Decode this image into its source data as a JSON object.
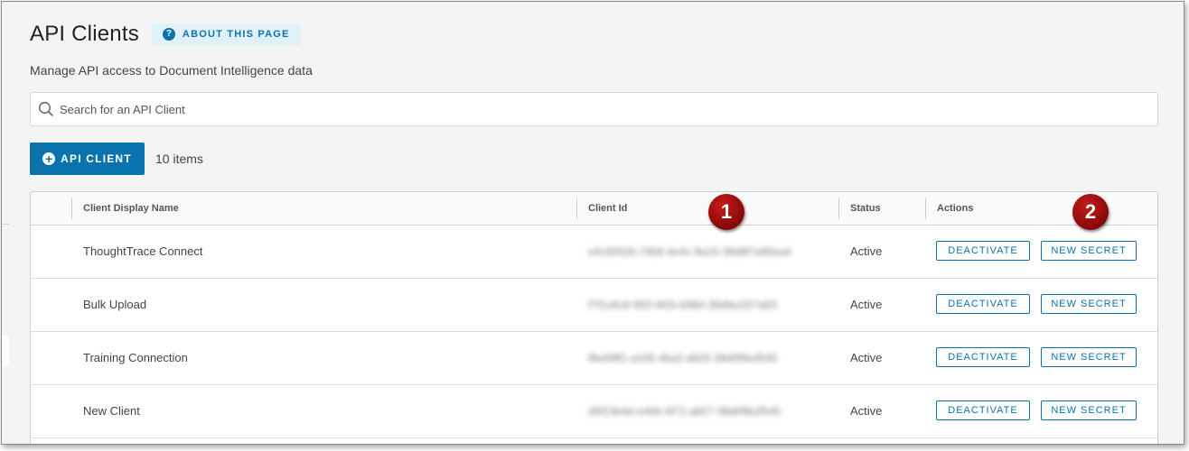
{
  "header": {
    "title": "API Clients",
    "about_label": "ABOUT THIS PAGE",
    "about_icon": "?",
    "subtitle": "Manage API access to Document Intelligence data"
  },
  "search": {
    "placeholder": "Search for an API Client",
    "value": ""
  },
  "toolbar": {
    "add_label": "API CLIENT",
    "add_icon": "+",
    "count": "10 items"
  },
  "table": {
    "columns": [
      "Client Display Name",
      "Client Id",
      "Status",
      "Actions"
    ],
    "rows": [
      {
        "name": "ThoughtTrace Connect",
        "client_id": "e4c8302b-7d58-4e4c-9a15-38d8f7a90ea4",
        "status": "Active",
        "deactivate": "DEACTIVATE",
        "new_secret": "NEW SECRET"
      },
      {
        "name": "Bulk Upload",
        "client_id": "f7f1e6c8-9f2f-4f2b-b98d-38d8a1f27a63",
        "status": "Active",
        "deactivate": "DEACTIVATE",
        "new_secret": "NEW SECRET"
      },
      {
        "name": "Training Connection",
        "client_id": "f8a48ff1-a2d5-4ba2-a820-38d0f8a3545",
        "status": "Active",
        "deactivate": "DEACTIVATE",
        "new_secret": "NEW SECRET"
      },
      {
        "name": "New Client",
        "client_id": "d5f23b4d-e40b-4f72-a827-38d0f8a3545",
        "status": "Active",
        "deactivate": "DEACTIVATE",
        "new_secret": "NEW SECRET"
      }
    ]
  },
  "markers": [
    "1",
    "2"
  ],
  "colors": {
    "accent": "#0a72ad",
    "accent_light": "#e1f1fa",
    "marker": "#8b0a0a",
    "page_bg": "#f4f4f4"
  }
}
